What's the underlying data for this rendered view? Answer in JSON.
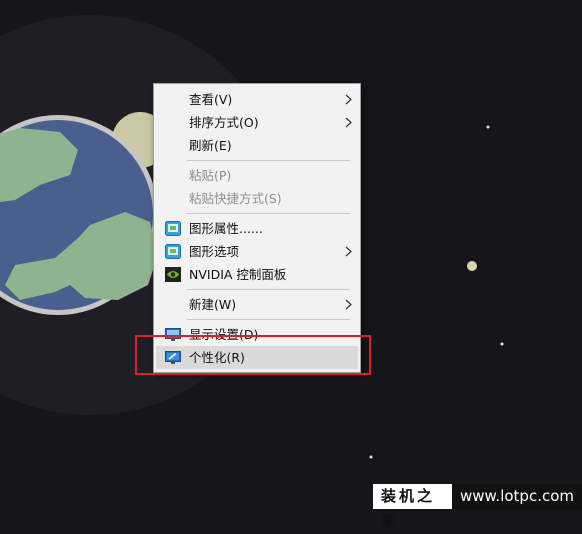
{
  "context_menu": {
    "items": [
      {
        "label": "查看(V)",
        "submenu": true
      },
      {
        "label": "排序方式(O)",
        "submenu": true
      },
      {
        "label": "刷新(E)"
      },
      {
        "label": "粘贴(P)",
        "disabled": true
      },
      {
        "label": "粘贴快捷方式(S)",
        "disabled": true
      },
      {
        "label": "图形属性......",
        "icon": "intel-graphics-icon"
      },
      {
        "label": "图形选项",
        "icon": "intel-graphics-icon",
        "submenu": true
      },
      {
        "label": "NVIDIA 控制面板",
        "icon": "nvidia-icon"
      },
      {
        "label": "新建(W)",
        "submenu": true
      },
      {
        "label": "显示设置(D)",
        "icon": "display-settings-icon"
      },
      {
        "label": "个性化(R)",
        "icon": "personalize-icon",
        "highlighted": true
      }
    ]
  },
  "highlight_box_color": "#d6202a",
  "watermark": {
    "site_name": "装机之家",
    "url": "www.lotpc.com"
  }
}
